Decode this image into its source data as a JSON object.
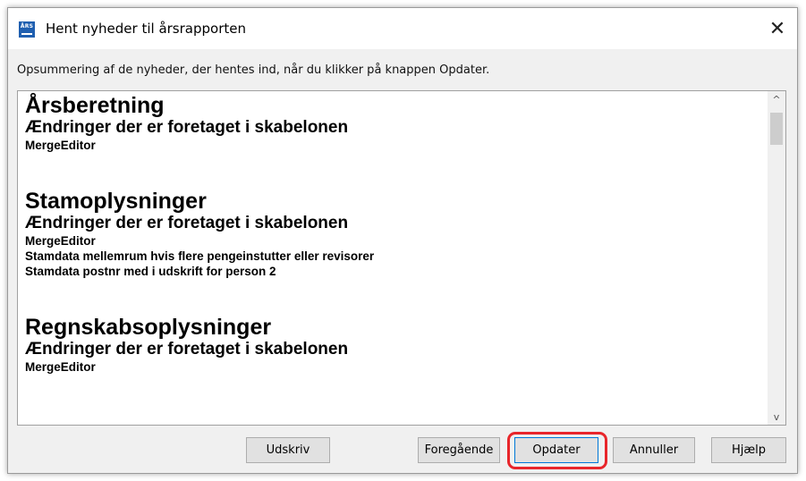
{
  "window": {
    "title": "Hent nyheder til årsrapporten",
    "icon": "ars-app-icon",
    "icon_text": "ÅRS",
    "close": "✕"
  },
  "summary_label": "Opsummering af de nyheder, der hentes ind, når du klikker på knappen Opdater.",
  "sections": [
    {
      "title": "Årsberetning",
      "subtitle": "Ændringer der er foretaget i skabelonen",
      "items": [
        "MergeEditor"
      ]
    },
    {
      "title": "Stamoplysninger",
      "subtitle": "Ændringer der er foretaget i skabelonen",
      "items": [
        "MergeEditor",
        "Stamdata mellemrum hvis flere pengeinstutter eller revisorer",
        "Stamdata postnr med i udskrift for person 2"
      ]
    },
    {
      "title": "Regnskabsoplysninger",
      "subtitle": "Ændringer der er foretaget i skabelonen",
      "items": [
        "MergeEditor"
      ]
    }
  ],
  "scrollbar": {
    "up": "^",
    "down": "v"
  },
  "buttons": {
    "print": "Udskriv",
    "previous": "Foregående",
    "update": "Opdater",
    "cancel": "Annuller",
    "help": "Hjælp"
  },
  "colors": {
    "highlight": "#e8262b",
    "app_icon": "#1f5fb0",
    "default_button_border": "#0078d7"
  }
}
